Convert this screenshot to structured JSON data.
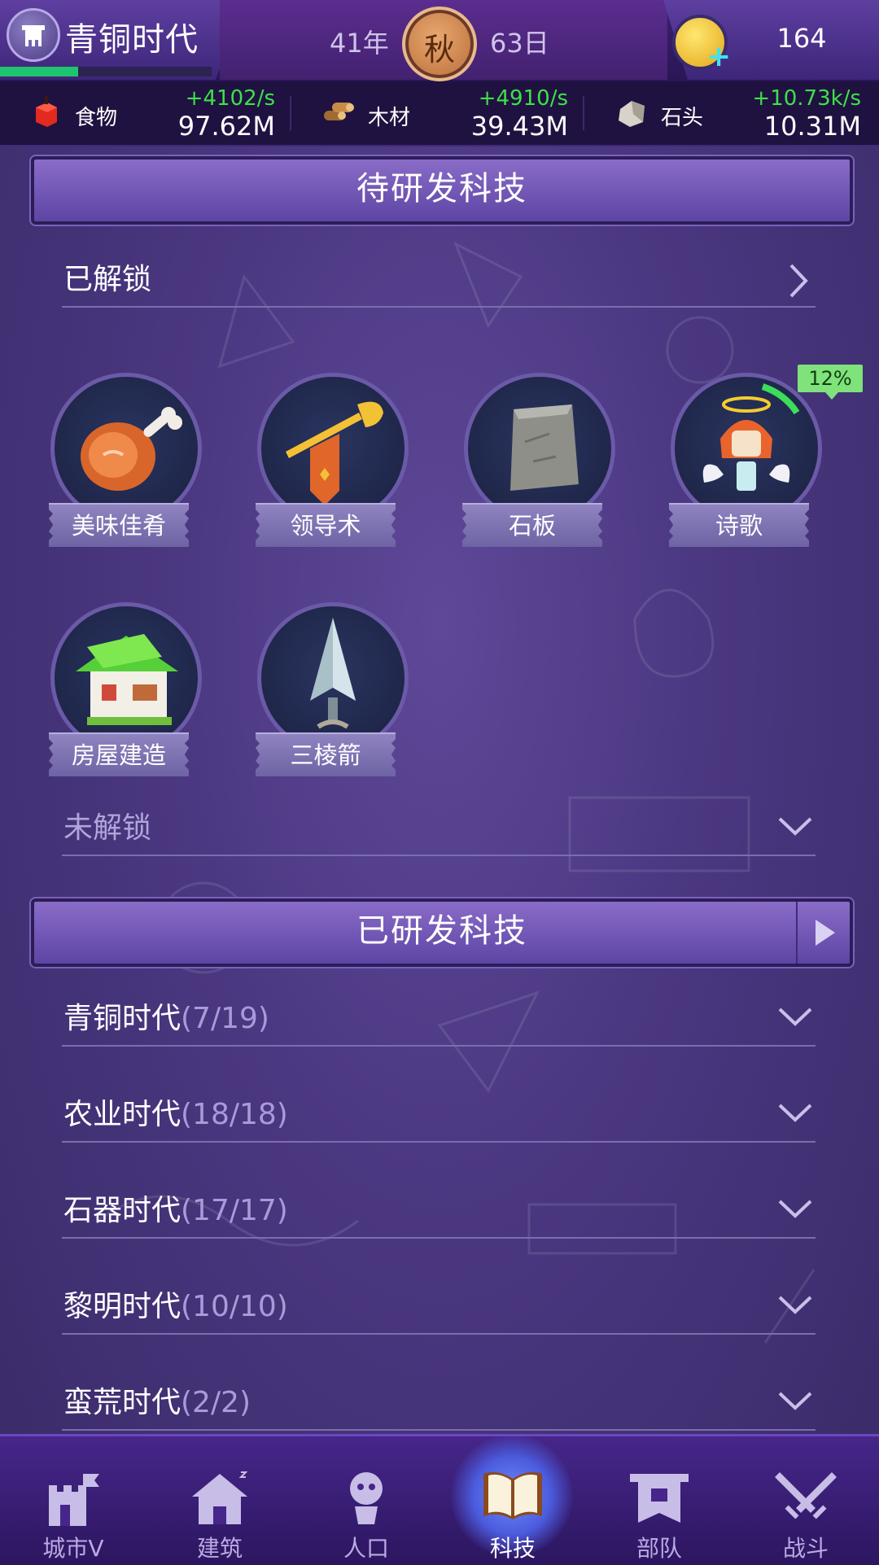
{
  "topbar": {
    "era_name": "青铜时代",
    "era_progress": 0.37,
    "year": "41年",
    "season": "秋",
    "day": "63日",
    "coins": "164"
  },
  "resources": [
    {
      "name": "食物",
      "rate": "+4102/s",
      "amount": "97.62M",
      "icon": "meat-icon"
    },
    {
      "name": "木材",
      "rate": "+4910/s",
      "amount": "39.43M",
      "icon": "wood-icon"
    },
    {
      "name": "石头",
      "rate": "+10.73k/s",
      "amount": "10.31M",
      "icon": "stone-icon"
    }
  ],
  "pending": {
    "title": "待研发科技",
    "unlocked_label": "已解锁",
    "locked_label": "未解锁",
    "techs": [
      {
        "name": "美味佳肴",
        "icon": "roast-meat-icon"
      },
      {
        "name": "领导术",
        "icon": "trumpet-icon"
      },
      {
        "name": "石板",
        "icon": "stone-tablet-icon"
      },
      {
        "name": "诗歌",
        "icon": "angel-icon",
        "progress": "12%"
      },
      {
        "name": "房屋建造",
        "icon": "house-icon"
      },
      {
        "name": "三棱箭",
        "icon": "arrowhead-icon"
      }
    ]
  },
  "researched": {
    "title": "已研发科技",
    "eras": [
      {
        "name": "青铜时代",
        "count": "(7/19)"
      },
      {
        "name": "农业时代",
        "count": "(18/18)"
      },
      {
        "name": "石器时代",
        "count": "(17/17)"
      },
      {
        "name": "黎明时代",
        "count": "(10/10)"
      },
      {
        "name": "蛮荒时代",
        "count": "(2/2)"
      }
    ]
  },
  "nav": [
    {
      "label": "城市V",
      "icon": "castle-icon"
    },
    {
      "label": "建筑",
      "icon": "house-icon"
    },
    {
      "label": "人口",
      "icon": "person-icon"
    },
    {
      "label": "科技",
      "icon": "book-icon",
      "active": true
    },
    {
      "label": "部队",
      "icon": "banner-icon"
    },
    {
      "label": "战斗",
      "icon": "crossed-swords-icon"
    }
  ]
}
